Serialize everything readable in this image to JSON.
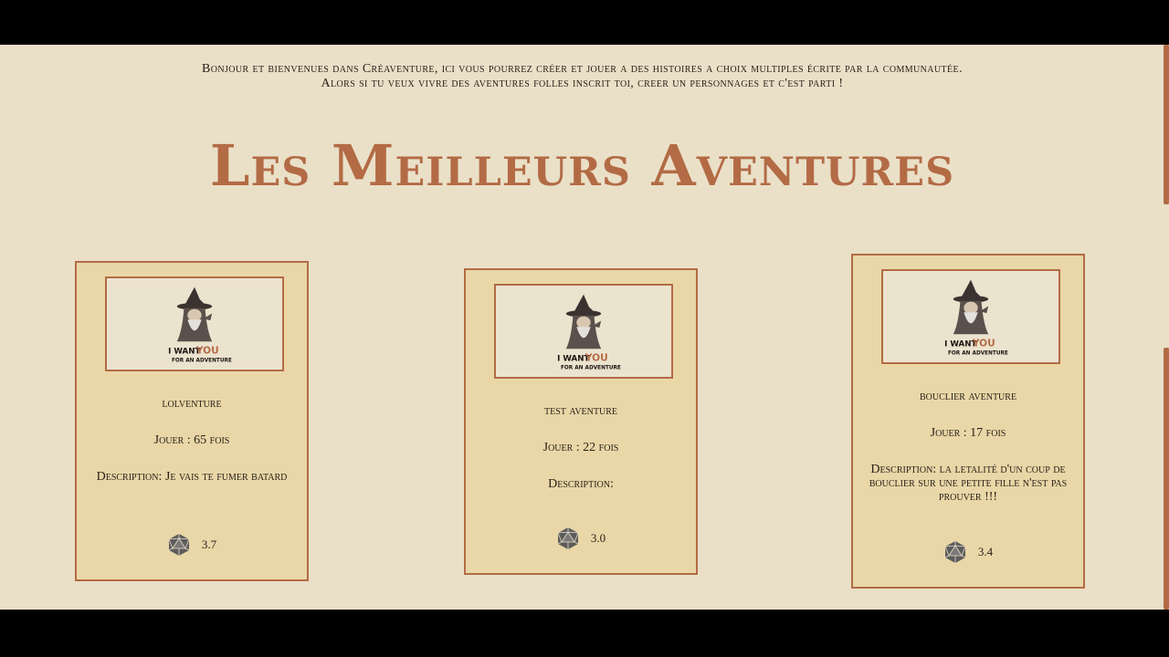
{
  "intro": {
    "line1": "Bonjour et bienvenues dans Créaventure, ici vous pourrez créer et jouer a des histoires a choix multiples écrite par la communautée.",
    "line2": "Alors si tu veux vivre des aventures folles inscrit toi, creer un personnages et c'est parti !"
  },
  "page_title": "Les Meilleurs Aventures",
  "thumbnail": {
    "line1": "I WANT",
    "highlight": "YOU",
    "line2": "FOR AN ADVENTURE"
  },
  "cards": [
    {
      "name": "lolventure",
      "plays": "Jouer : 65 fois",
      "description": "Description: Je vais te fumer batard",
      "rating": "3.7",
      "rating_icon": "d20-die-icon"
    },
    {
      "name": "test aventure",
      "plays": "Jouer : 22 fois",
      "description": "Description:",
      "rating": "3.0",
      "rating_icon": "d20-die-icon"
    },
    {
      "name": "bouclier aventure",
      "plays": "Jouer : 17 fois",
      "description": "Description: la letalité d'un coup de bouclier sur une petite fille n'est pas prouver !!!",
      "rating": "3.4",
      "rating_icon": "d20-die-icon"
    }
  ],
  "colors": {
    "background": "#eae0c8",
    "card": "#e9d7a8",
    "accent": "#b36b45",
    "text": "#2a2118"
  }
}
